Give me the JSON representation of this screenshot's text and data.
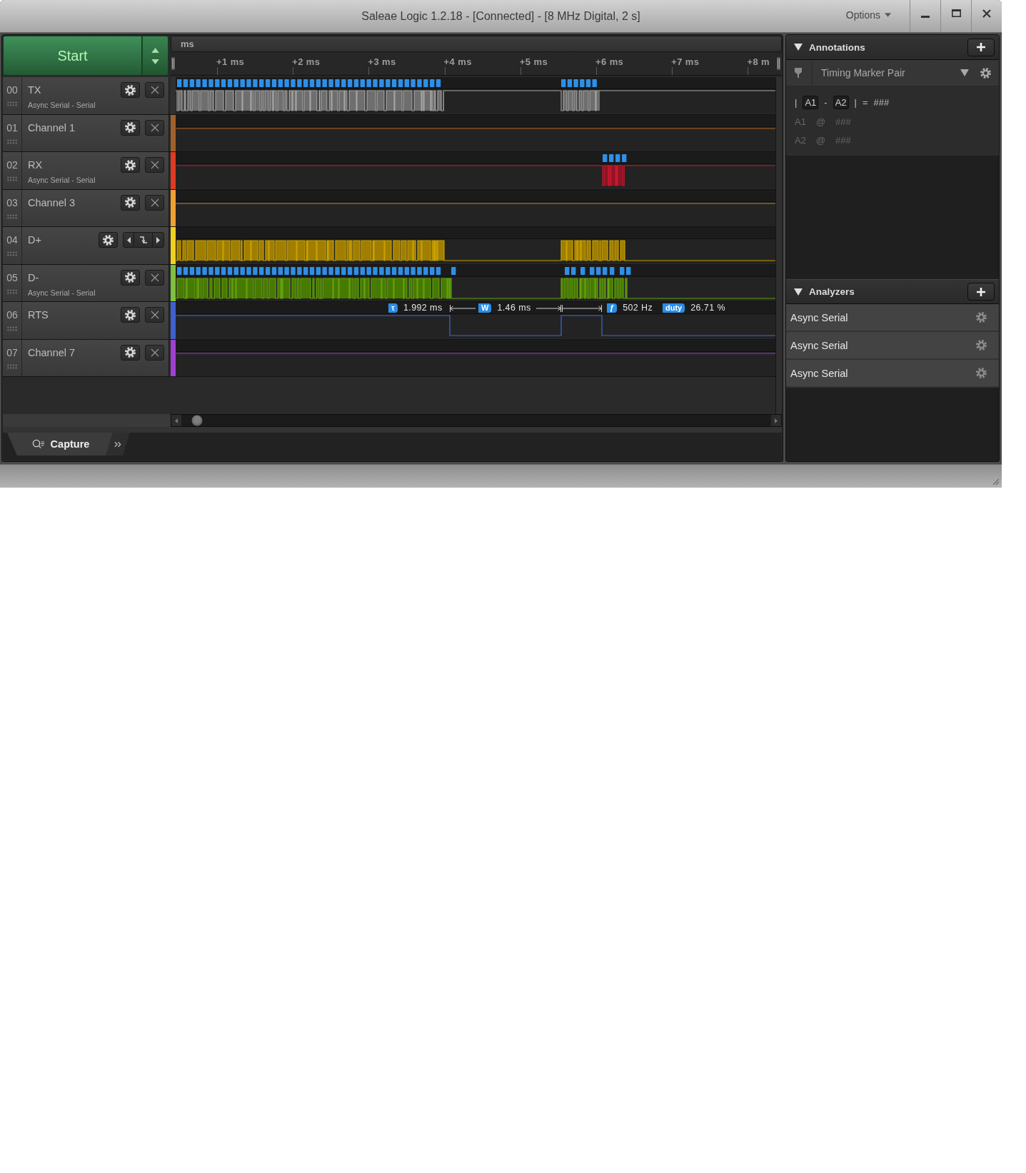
{
  "window": {
    "title": "Saleae Logic 1.2.18 - [Connected] - [8 MHz Digital, 2 s]",
    "menu": "Options"
  },
  "start_button": {
    "label": "Start"
  },
  "timeline": {
    "unit": "ms",
    "ticks": [
      "+1 ms",
      "+2 ms",
      "+3 ms",
      "+4 ms",
      "+5 ms",
      "+6 ms",
      "+7 ms",
      "+8 m"
    ]
  },
  "channels": [
    {
      "number": "00",
      "name": "TX",
      "analyzer": "Async Serial - Serial",
      "color": "#303030",
      "trigger": false
    },
    {
      "number": "01",
      "name": "Channel 1",
      "color": "#a0602a",
      "trigger": false
    },
    {
      "number": "02",
      "name": "RX",
      "analyzer": "Async Serial - Serial",
      "color": "#e03a20",
      "trigger": false
    },
    {
      "number": "03",
      "name": "Channel 3",
      "color": "#f0a030",
      "trigger": false
    },
    {
      "number": "04",
      "name": "D+",
      "color": "#f0d020",
      "trigger": true
    },
    {
      "number": "05",
      "name": "D-",
      "analyzer": "Async Serial - Serial",
      "color": "#80c040",
      "trigger": false
    },
    {
      "number": "06",
      "name": "RTS",
      "color": "#4060d0",
      "trigger": false,
      "measurements": [
        {
          "symbol": "τ",
          "value": "1.992 ms"
        },
        {
          "symbol": "W",
          "value": "1.46 ms"
        },
        {
          "symbol": "ƒ",
          "value": "502 Hz"
        },
        {
          "symbol": "duty",
          "value": "26.71 %"
        }
      ]
    },
    {
      "number": "07",
      "name": "Channel 7",
      "color": "#a040d0",
      "trigger": false
    }
  ],
  "tabs": [
    {
      "label": "Capture",
      "selected": true
    }
  ],
  "annotations": {
    "title": "Annotations",
    "expanded": true,
    "marker_pair": {
      "label": "Timing Marker Pair"
    },
    "formula": [
      {
        "kind": "plain",
        "text": "|"
      },
      {
        "kind": "chip",
        "text": "A1"
      },
      {
        "kind": "plain",
        "text": "-"
      },
      {
        "kind": "chip",
        "text": "A2"
      },
      {
        "kind": "plain",
        "text": "|"
      },
      {
        "kind": "plain",
        "text": "="
      },
      {
        "kind": "plain",
        "text": "###"
      }
    ],
    "markers": [
      {
        "name": "A1",
        "at": "@",
        "value": "###",
        "disabled": true
      },
      {
        "name": "A2",
        "at": "@",
        "value": "###",
        "disabled": true
      }
    ]
  },
  "analyzers": {
    "title": "Analyzers",
    "expanded": true,
    "items": [
      {
        "name": "Async Serial"
      },
      {
        "name": "Async Serial"
      },
      {
        "name": "Async Serial"
      }
    ]
  }
}
